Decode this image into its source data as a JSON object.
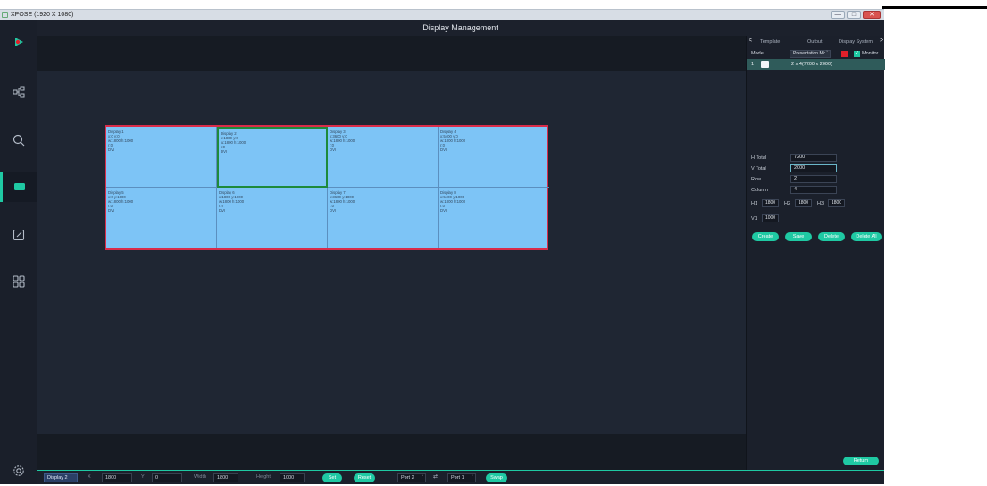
{
  "window": {
    "title": "XPOSE (1920 X 1080)",
    "minimize": "—",
    "maximize": "□",
    "close": "✕"
  },
  "header": {
    "title": "Display Management"
  },
  "sidebar": {
    "items": [
      {
        "name": "logo-icon"
      },
      {
        "name": "network-icon"
      },
      {
        "name": "search-icon"
      },
      {
        "name": "display-icon"
      },
      {
        "name": "edit-icon"
      },
      {
        "name": "apps-icon"
      },
      {
        "name": "settings-icon"
      }
    ]
  },
  "grid": {
    "cells": [
      {
        "lines": [
          "Display 1",
          "x:0 y:0",
          "w:1800 h:1000",
          "r:0",
          "DVI"
        ]
      },
      {
        "lines": [
          "Display 2",
          "x:1800 y:0",
          "w:1800 h:1000",
          "r:0",
          "DVI"
        ],
        "selected": true
      },
      {
        "lines": [
          "Display 3",
          "x:3600 y:0",
          "w:1800 h:1000",
          "r:0",
          "DVI"
        ]
      },
      {
        "lines": [
          "Display 4",
          "x:5400 y:0",
          "w:1800 h:1000",
          "r:0",
          "DVI"
        ]
      },
      {
        "lines": [
          "Display 5",
          "x:0 y:1000",
          "w:1800 h:1000",
          "r:0",
          "DVI"
        ]
      },
      {
        "lines": [
          "Display 6",
          "x:1800 y:1000",
          "w:1800 h:1000",
          "r:0",
          "DVI"
        ]
      },
      {
        "lines": [
          "Display 7",
          "x:3600 y:1000",
          "w:1800 h:1000",
          "r:0",
          "DVI"
        ]
      },
      {
        "lines": [
          "Display 8",
          "x:5400 y:1000",
          "w:1800 h:1000",
          "r:0",
          "DVI"
        ]
      }
    ]
  },
  "right_panel": {
    "tabs": {
      "prev": "<",
      "template": "Template",
      "output": "Output",
      "display_system": "Display System",
      "next": ">"
    },
    "mode_label": "Mode",
    "mode_value": "Presentation Mc",
    "monitor_label": "Monitor",
    "template_row": {
      "index": "1",
      "label": "2 x 4(7200 x 2000)"
    },
    "h_total_label": "H Total",
    "h_total": "7200",
    "v_total_label": "V Total",
    "v_total": "2000",
    "row_label": "Row",
    "row": "2",
    "column_label": "Column",
    "column": "4",
    "h1_label": "H1",
    "h1": "1800",
    "h2_label": "H2",
    "h2": "1800",
    "h3_label": "H3",
    "h3": "1800",
    "v1_label": "V1",
    "v1": "1000",
    "buttons": {
      "create": "Create",
      "save": "Save",
      "delete": "Delete",
      "delete_all": "Delete All",
      "return": "Return"
    }
  },
  "bottom_bar": {
    "display_select": "Display 2",
    "x_label": "X",
    "x": "1800",
    "y_label": "Y",
    "y": "0",
    "width_label": "Width",
    "width": "1800",
    "height_label": "Height",
    "height": "1000",
    "set": "Set",
    "reset": "Reset",
    "port_a": "Port 2",
    "port_b": "Port 1",
    "swap": "Swap"
  },
  "colors": {
    "accent": "#1fc9a3",
    "grid_fill": "#7dc4f6",
    "grid_border": "#d92c4a",
    "selected_border": "#1e8a3c"
  }
}
